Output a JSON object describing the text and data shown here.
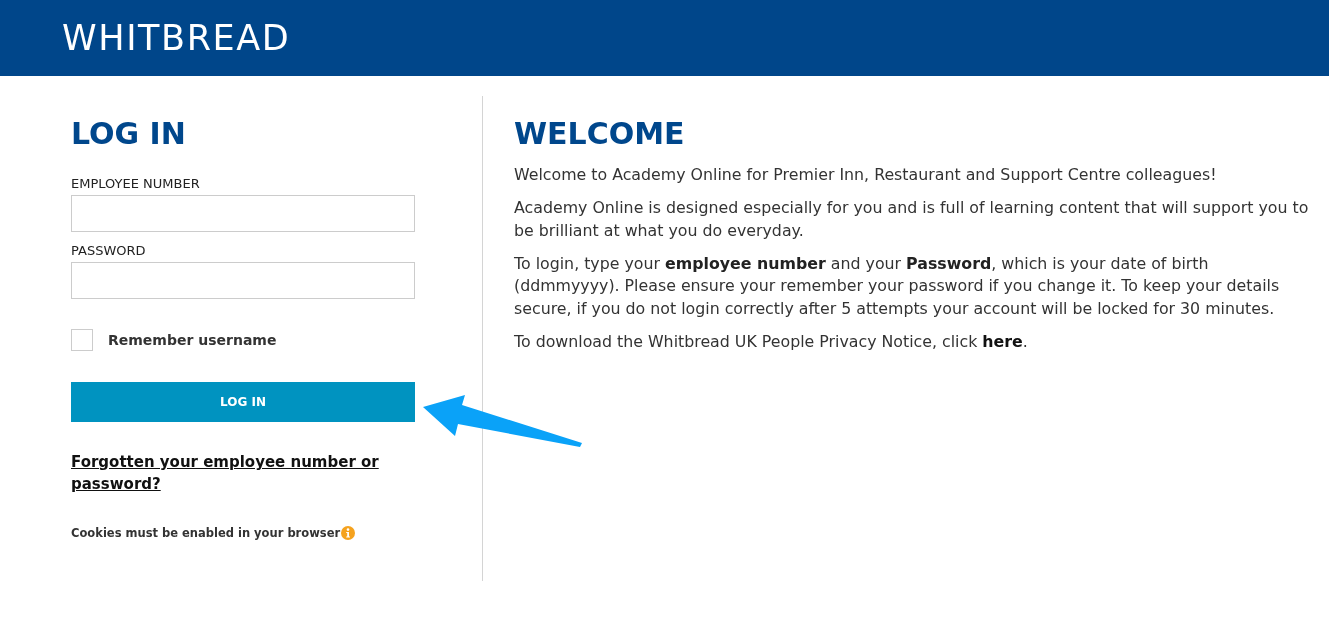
{
  "header": {
    "logo": "WHITBREAD"
  },
  "login": {
    "title": "LOG IN",
    "fields": [
      {
        "label": "EMPLOYEE NUMBER"
      },
      {
        "label": "PASSWORD"
      }
    ],
    "remember": {
      "label": "Remember username",
      "checked": false
    },
    "button": "LOG IN",
    "forgot_link": "Forgotten your employee number or password?",
    "cookies_note": "Cookies must be enabled in your browser"
  },
  "welcome": {
    "title": "WELCOME",
    "paragraphs": [
      "Welcome to Academy Online for Premier Inn, Restaurant and Support Centre colleagues!",
      "Academy Online is designed especially for you and is full of learning content that will support you to be brilliant at what you do everyday.",
      "To login, type your **employee number** and your **Password**, which is your date of birth (ddmmyyyy). Please ensure your remember your password if you change it. To keep your details secure, if you do not login correctly after 5 attempts your account will be locked for 30 minutes."
    ],
    "privacy": {
      "text": "To download the Whitbread UK People Privacy Notice, click ",
      "link": "here",
      "after": "."
    }
  }
}
